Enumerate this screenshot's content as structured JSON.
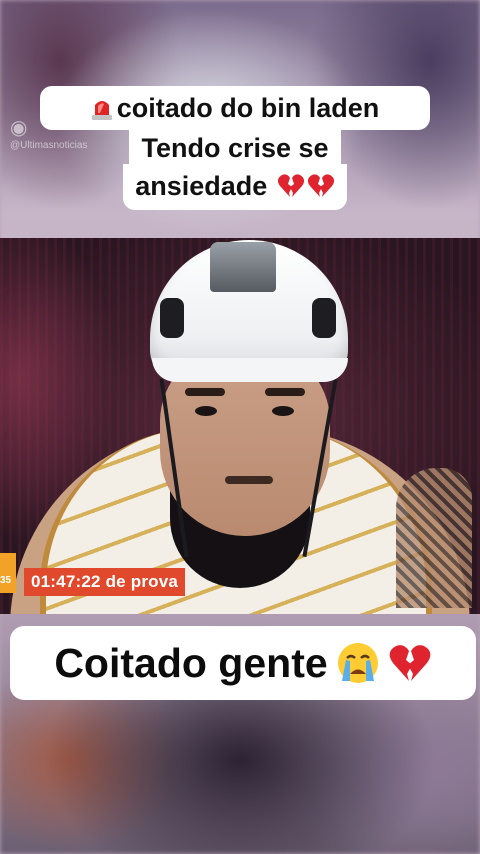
{
  "watermark": {
    "text": "@Ultimasnoticias"
  },
  "caption_top": {
    "line1": "coitado do bin laden",
    "line2": "Tendo crise se",
    "line3": "ansiedade",
    "line1_icon": "siren-icon",
    "line3_icons": [
      "broken-heart-icon",
      "broken-heart-icon"
    ]
  },
  "video": {
    "timer": "01:47:22 de prova",
    "corner_text": "35",
    "colors": {
      "timer_bg": "#e0492c",
      "corner_accent": "#f2a226"
    }
  },
  "caption_bottom": {
    "text": "Coitado gente",
    "icons": [
      "crying-face-icon",
      "broken-heart-icon"
    ]
  }
}
